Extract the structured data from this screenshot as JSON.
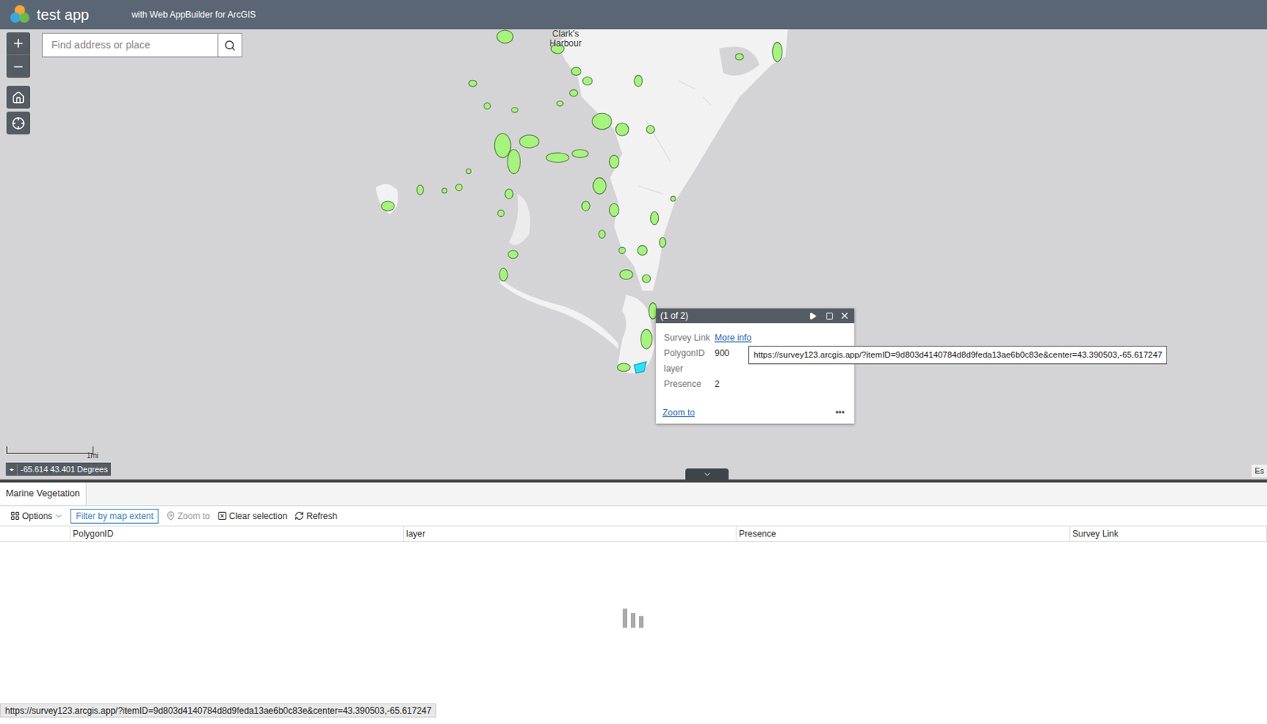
{
  "app": {
    "title": "test app",
    "subtitle": "with Web AppBuilder for ArcGIS"
  },
  "search": {
    "placeholder": "Find address or place"
  },
  "map": {
    "place_label": "Clark's Harbour",
    "scale_label": "1mi",
    "coordinates": "-65.614 43.401 Degrees",
    "attribution": "Es"
  },
  "popup": {
    "counter": "(1 of 2)",
    "fields": [
      {
        "label": "Survey Link",
        "value": "More info",
        "kind": "link"
      },
      {
        "label": "PolygonID",
        "value": "900",
        "kind": "text"
      },
      {
        "label": "layer",
        "value": "",
        "kind": "text"
      },
      {
        "label": "Presence",
        "value": "2",
        "kind": "text"
      }
    ],
    "zoom_link": "Zoom to",
    "more": "•••"
  },
  "tooltip": {
    "text": "https://survey123.arcgis.app/?itemID=9d803d4140784d8d9feda13ae6b0c83e&center=43.390503,-65.617247"
  },
  "table": {
    "tabs": [
      {
        "label": "Marine Vegetation",
        "selected": true
      }
    ],
    "toolbar": [
      {
        "label": "Options",
        "kind": "menu",
        "disabled": false
      },
      {
        "label": "Filter by map extent",
        "kind": "toggle",
        "disabled": false
      },
      {
        "label": "Zoom to",
        "kind": "zoom",
        "disabled": true
      },
      {
        "label": "Clear selection",
        "kind": "clear",
        "disabled": false
      },
      {
        "label": "Refresh",
        "kind": "refresh",
        "disabled": false
      }
    ],
    "columns": [
      "PolygonID",
      "layer",
      "Presence",
      "Survey Link"
    ],
    "loading": true
  },
  "status_bar": {
    "text": "https://survey123.arcgis.app/?itemID=9d803d4140784d8d9feda13ae6b0c83e&center=43.390503,-65.617247"
  }
}
